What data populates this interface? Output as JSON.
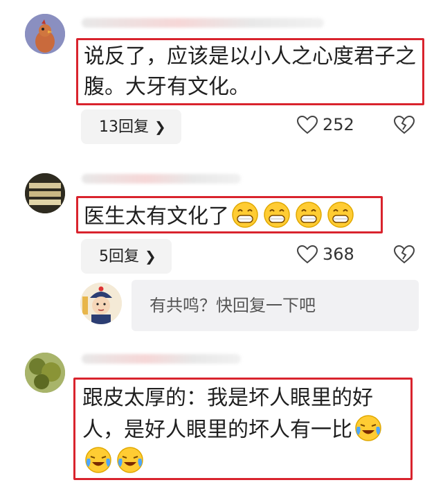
{
  "comments": [
    {
      "content": "说反了，应该是以小人之心度君子之腹。大牙有文化。",
      "reply_label": "13回复",
      "likes": "252"
    },
    {
      "content": "医生太有文化了",
      "emoji_count": 4,
      "emoji": "grinning-face",
      "reply_label": "5回复",
      "likes": "368"
    },
    {
      "content": "跟皮太厚的：我是坏人眼里的好人，是好人眼里的坏人有一比",
      "emoji_count": 3,
      "emoji": "crying-laughing-face"
    }
  ],
  "reply_box": {
    "placeholder": "有共鸣？快回复一下吧"
  },
  "colors": {
    "highlight_border": "#d9232d",
    "pill_bg": "#f3f3f3"
  }
}
